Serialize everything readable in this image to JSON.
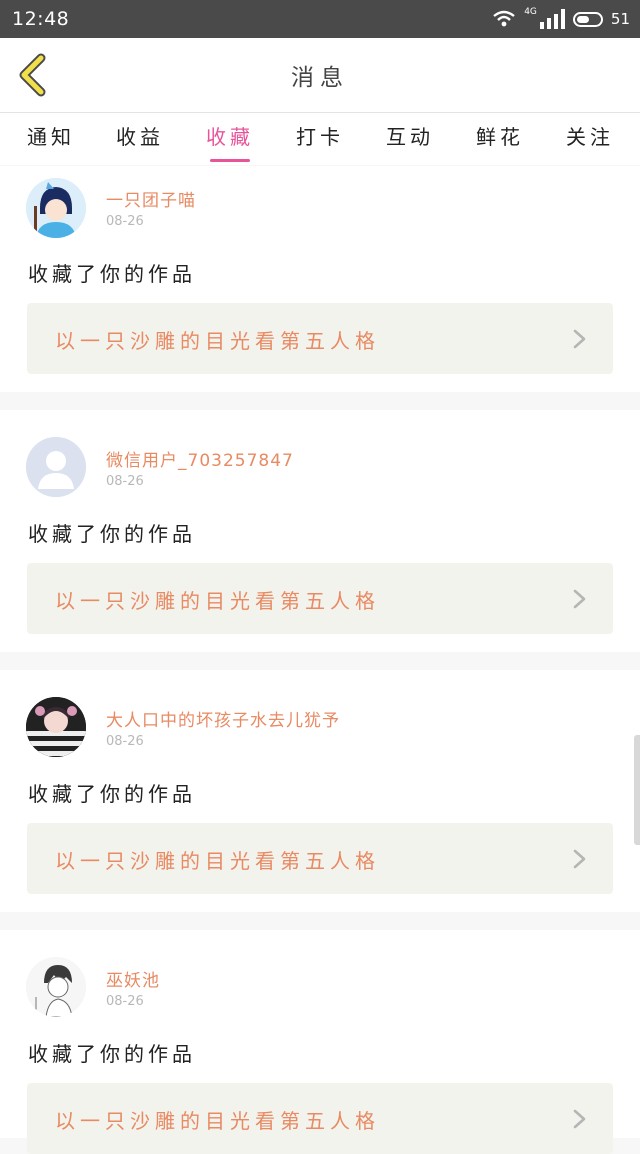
{
  "status_bar": {
    "time": "12:48",
    "network": "4G",
    "battery": "51"
  },
  "header": {
    "title": "消息",
    "back_icon": "chevron-left-icon",
    "accent_color": "#f2e04a"
  },
  "tabs": [
    {
      "label": "通知",
      "active": false
    },
    {
      "label": "收益",
      "active": false
    },
    {
      "label": "收藏",
      "active": true
    },
    {
      "label": "打卡",
      "active": false
    },
    {
      "label": "互动",
      "active": false
    },
    {
      "label": "鲜花",
      "active": false
    },
    {
      "label": "关注",
      "active": false
    }
  ],
  "colors": {
    "active_tab": "#e8549a",
    "name_text": "#e88a62",
    "link_bg": "#f3f3ee"
  },
  "messages": [
    {
      "name": "一只团子喵",
      "date": "08-26",
      "action": "收藏了你的作品",
      "work": "以一只沙雕的目光看第五人格",
      "avatar": "anime-boy-avatar"
    },
    {
      "name": "微信用户_703257847",
      "date": "08-26",
      "action": "收藏了你的作品",
      "work": "以一只沙雕的目光看第五人格",
      "avatar": "default-user-avatar"
    },
    {
      "name": "大人口中的坏孩子水去儿犹予",
      "date": "08-26",
      "action": "收藏了你的作品",
      "work": "以一只沙雕的目光看第五人格",
      "avatar": "striped-anime-avatar"
    },
    {
      "name": "巫妖池",
      "date": "08-26",
      "action": "收藏了你的作品",
      "work": "以一只沙雕的目光看第五人格",
      "avatar": "sketch-boy-avatar"
    }
  ]
}
